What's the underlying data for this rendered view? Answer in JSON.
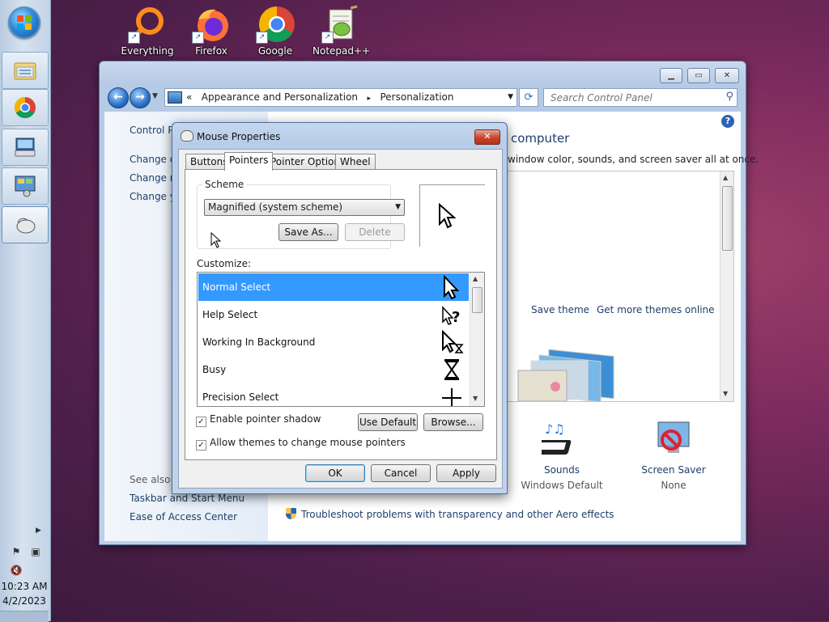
{
  "desktop": {
    "icons": [
      {
        "label": "Everything"
      },
      {
        "label": "Firefox"
      },
      {
        "label": "Google"
      },
      {
        "label": "Notepad++"
      }
    ]
  },
  "taskbar": {
    "clock_time": "10:23 AM",
    "clock_date": "4/2/2023"
  },
  "control_panel": {
    "breadcrumb_prefix": "«",
    "breadcrumb_1": "Appearance and Personalization",
    "breadcrumb_sep": "▸",
    "breadcrumb_2": "Personalization",
    "search_placeholder": "Search Control Panel",
    "left_links": [
      "Control Pa",
      "Change de",
      "Change m",
      "Change yo"
    ],
    "see_also_label": "See also",
    "see_also_links": [
      "Taskbar and Start Menu",
      "Ease of Access Center"
    ],
    "heading": "computer",
    "subtext": "window color, sounds, and screen saver all at once.",
    "save_theme": "Save theme",
    "get_more_themes": "Get more themes online",
    "sounds_title": "Sounds",
    "sounds_sub": "Windows Default",
    "screensaver_title": "Screen Saver",
    "screensaver_sub": "None",
    "troubleshoot": "Troubleshoot problems with transparency and other Aero effects"
  },
  "mouse_dialog": {
    "title": "Mouse Properties",
    "tabs": [
      "Buttons",
      "Pointers",
      "Pointer Options",
      "Wheel"
    ],
    "scheme_label": "Scheme",
    "scheme_value": "Magnified (system scheme)",
    "save_as": "Save As...",
    "delete": "Delete",
    "customize_label": "Customize:",
    "pointer_items": [
      "Normal Select",
      "Help Select",
      "Working In Background",
      "Busy",
      "Precision Select"
    ],
    "enable_shadow": "Enable pointer shadow",
    "allow_themes": "Allow themes to change mouse pointers",
    "use_default": "Use Default",
    "browse": "Browse...",
    "ok": "OK",
    "cancel": "Cancel",
    "apply": "Apply"
  }
}
